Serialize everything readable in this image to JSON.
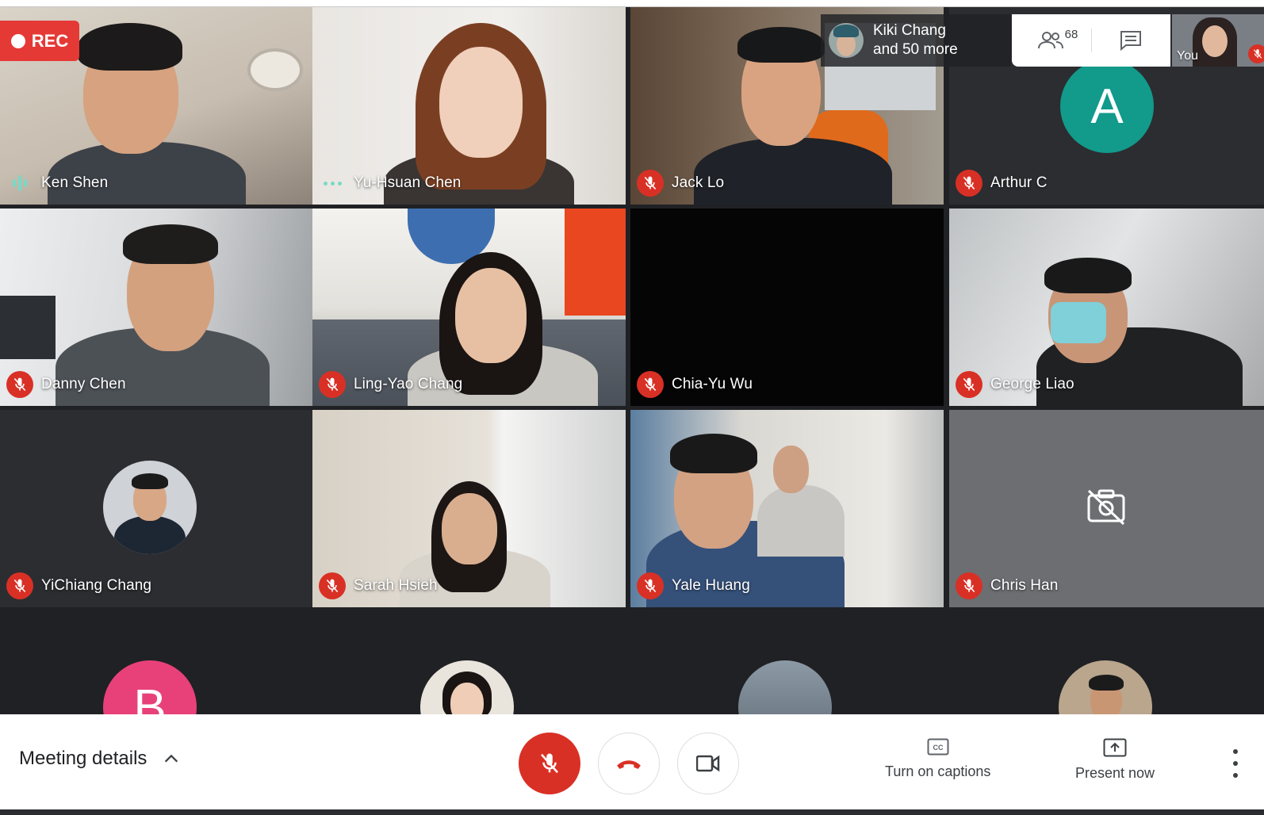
{
  "recording": {
    "label": "REC"
  },
  "top_bar": {
    "presence": {
      "line1": "Kiki Chang",
      "line2": "and 50 more"
    },
    "participants_count": "68",
    "you_label": "You"
  },
  "participants": [
    {
      "name": "Ken Shen",
      "status": "speaking"
    },
    {
      "name": "Yu-Hsuan Chen",
      "status": "active"
    },
    {
      "name": "Jack Lo",
      "status": "muted"
    },
    {
      "name": "Arthur C",
      "status": "muted",
      "avatar_letter": "A"
    },
    {
      "name": "Danny Chen",
      "status": "muted"
    },
    {
      "name": "Ling-Yao Chang",
      "status": "muted"
    },
    {
      "name": "Chia-Yu Wu",
      "status": "muted"
    },
    {
      "name": "George Liao",
      "status": "muted"
    },
    {
      "name": "YiChiang Chang",
      "status": "muted"
    },
    {
      "name": "Sarah Hsieh",
      "status": "muted"
    },
    {
      "name": "Yale Huang",
      "status": "muted"
    },
    {
      "name": "Chris Han",
      "status": "muted"
    }
  ],
  "partial_row": [
    {
      "avatar_letter": "B"
    }
  ],
  "controls": {
    "meeting_details": "Meeting details",
    "captions_label": "Turn on captions",
    "present_label": "Present now"
  },
  "colors": {
    "background": "#202124",
    "mute_red": "#d93025",
    "speaking_teal": "#7ad9c4",
    "avatar_a": "#129a8b",
    "avatar_b": "#e8417a",
    "rec_red": "#e53935"
  }
}
